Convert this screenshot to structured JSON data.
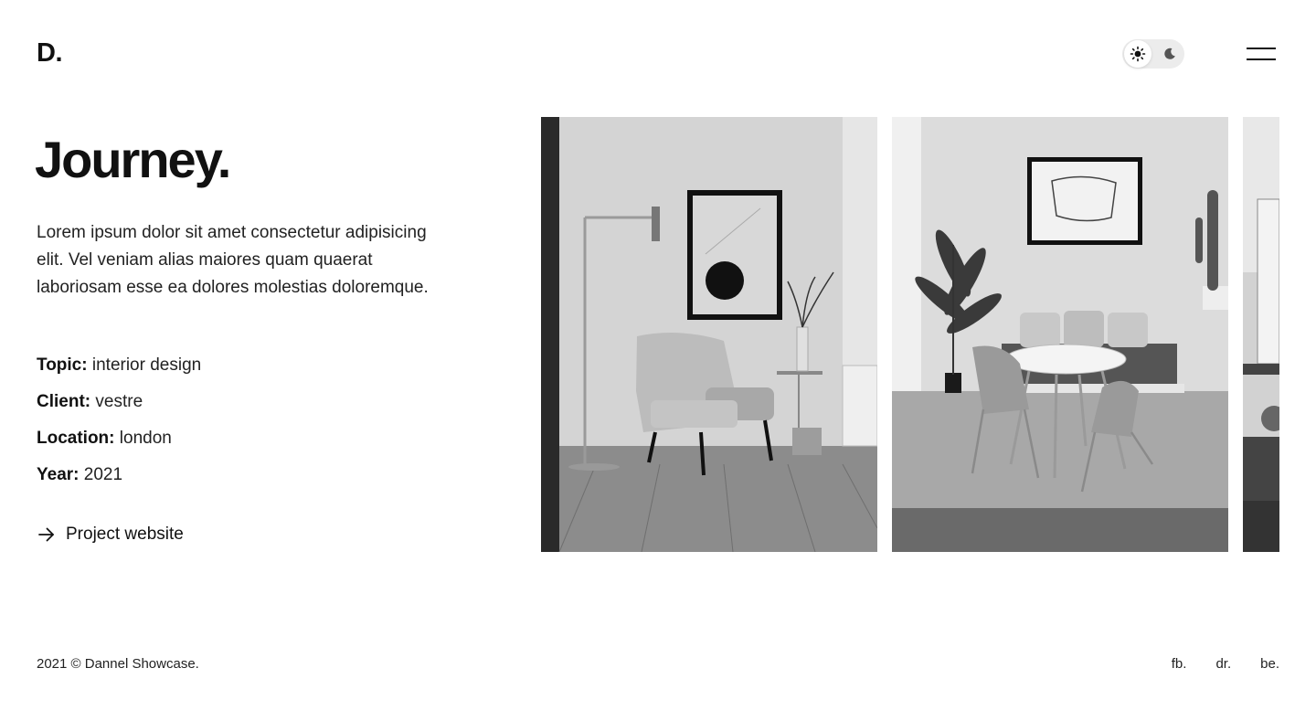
{
  "header": {
    "logo": "D.",
    "theme_toggle": {
      "light_icon": "sun-icon",
      "dark_icon": "moon-icon",
      "active": "light"
    },
    "menu_icon": "hamburger-icon"
  },
  "project": {
    "title": "Journey.",
    "description": "Lorem ipsum dolor sit amet consectetur adipisicing elit. Vel veniam alias maiores quam quaerat laboriosam esse ea dolores molestias doloremque.",
    "meta": [
      {
        "label": "Topic:",
        "value": "interior design"
      },
      {
        "label": "Client:",
        "value": "vestre"
      },
      {
        "label": "Location:",
        "value": "london"
      },
      {
        "label": "Year:",
        "value": "2021"
      }
    ],
    "link_label": "Project website",
    "link_icon": "arrow-right-icon"
  },
  "gallery": {
    "images": [
      "armchair-room-photo",
      "dining-room-photo",
      "office-room-photo"
    ]
  },
  "footer": {
    "copyright": "2021 © Dannel Showcase.",
    "social": [
      "fb.",
      "dr.",
      "be."
    ]
  }
}
